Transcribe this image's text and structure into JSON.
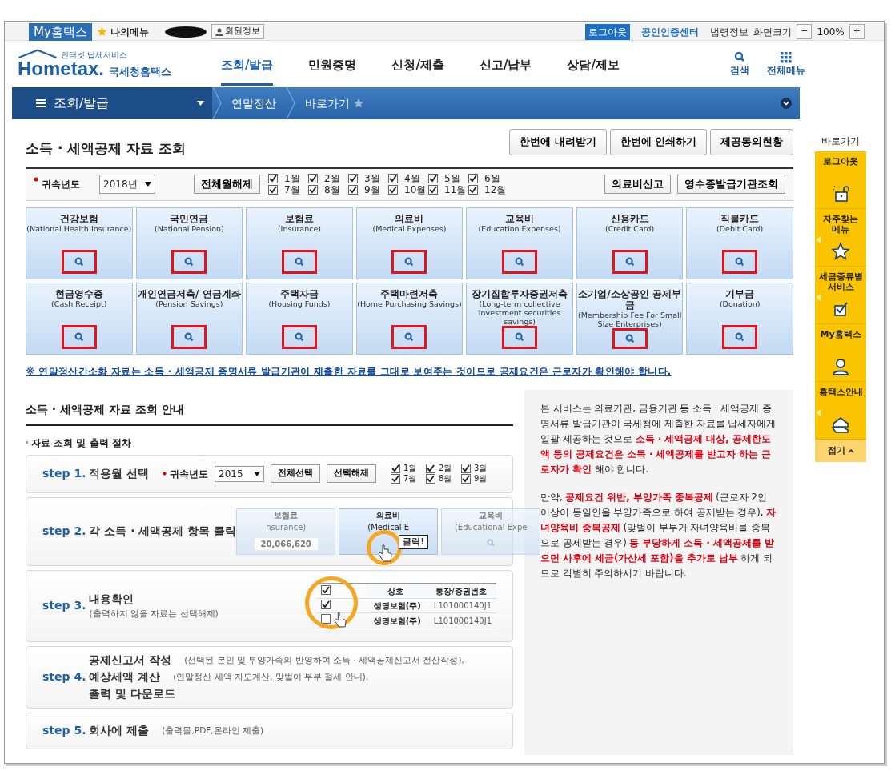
{
  "top_bar": {
    "brand": "My홈택스",
    "my_menu": "나의메뉴",
    "member_info": "회원정보",
    "logout": "로그아웃",
    "cert_center": "공인인증센터",
    "links": [
      "법령정보",
      "화면크기"
    ],
    "zoom_out": "−",
    "zoom": "100%",
    "zoom_in": "+"
  },
  "header": {
    "logo_small": "인터넷 납세서비스",
    "logo": "Hometax.",
    "logo_name": "국세청홈택스",
    "search": "검색",
    "all_menu": "전체메뉴",
    "nav": [
      {
        "label": "조회/발급",
        "selected": true
      },
      {
        "label": "민원증명",
        "selected": false
      },
      {
        "label": "신청/제출",
        "selected": false
      },
      {
        "label": "신고/납부",
        "selected": false
      },
      {
        "label": "상담/제보",
        "selected": false
      }
    ]
  },
  "breadcrumb": {
    "menu": "조회/발급",
    "items": [
      "연말정산",
      "바로가기"
    ]
  },
  "page": {
    "title": "소득 · 세액공제 자료 조회",
    "actions": [
      "한번에 내려받기",
      "한번에 인쇄하기",
      "제공동의현황"
    ]
  },
  "filter": {
    "year_label": "귀속년도",
    "year": "2018년",
    "clear_all": "전체월해제",
    "buttons": [
      "의료비신고",
      "영수증발급기관조회"
    ],
    "months": [
      {
        "label": "1월",
        "checked": true
      },
      {
        "label": "2월",
        "checked": true
      },
      {
        "label": "3월",
        "checked": true
      },
      {
        "label": "4월",
        "checked": true
      },
      {
        "label": "5월",
        "checked": true
      },
      {
        "label": "6월",
        "checked": true
      },
      {
        "label": "7월",
        "checked": true
      },
      {
        "label": "8월",
        "checked": true
      },
      {
        "label": "9월",
        "checked": true
      },
      {
        "label": "10월",
        "checked": true
      },
      {
        "label": "11월",
        "checked": true
      },
      {
        "label": "12월",
        "checked": true
      }
    ]
  },
  "categories": [
    {
      "name": "건강보험",
      "english": "(National Health Insurance)"
    },
    {
      "name": "국민연금",
      "english": "(National Pension)"
    },
    {
      "name": "보험료",
      "english": "(Insurance)"
    },
    {
      "name": "의료비",
      "english": "(Medical Expenses)"
    },
    {
      "name": "교육비",
      "english": "(Education Expenses)"
    },
    {
      "name": "신용카드",
      "english": "(Credit Card)"
    },
    {
      "name": "직불카드",
      "english": "(Debit Card)"
    },
    {
      "name": "현금영수증",
      "english": "(Cash Receipt)"
    },
    {
      "name": "개인연금저축/ 연금계좌",
      "english": "(Pension Savings)"
    },
    {
      "name": "주택자금",
      "english": "(Housing Funds)"
    },
    {
      "name": "주택마련저축",
      "english": "(Home Purchasing Savings)"
    },
    {
      "name": "장기집합투자증권저축",
      "english": "(Long-term collective investment securities savings)"
    },
    {
      "name": "소기업/소상공인 공제부금",
      "english": "(Membership Fee For Small Size Enterprises)"
    },
    {
      "name": "기부금",
      "english": "(Donation)"
    }
  ],
  "notice": "※ 연말정산간소화 자료는 소득 · 세액공제 증명서류 발급기관이 제출한 자료를 그대로 보여주는 것이므로 공제요건은 근로자가 확인해야 합니다.",
  "guide": {
    "title": "소득 · 세액공제 자료 조회 안내",
    "subtitle": "자료 조회 및 출력 절차",
    "steps": [
      {
        "kind": "months",
        "step": "step 1.",
        "lines": [
          {
            "title": "적용월 선택"
          }
        ],
        "year_label": "귀속년도",
        "year": "2015",
        "buttons": [
          "전체선택",
          "선택해제"
        ],
        "months": [
          {
            "label": "1월",
            "checked": true
          },
          {
            "label": "2월",
            "checked": true
          },
          {
            "label": "3월",
            "checked": true
          },
          {
            "label": "7월",
            "checked": true
          },
          {
            "label": "8월",
            "checked": true
          },
          {
            "label": "9월",
            "checked": true
          }
        ]
      },
      {
        "kind": "tiles",
        "step": "step 2.",
        "lines": [
          {
            "title": "각 소득 · 세액공제 항목 클릭"
          }
        ],
        "callout": "클릭!",
        "tiles": [
          {
            "name": "보험료",
            "english": "nsurance)",
            "amount": "20,066,620"
          },
          {
            "name": "의료비",
            "english": "(Medical E"
          },
          {
            "name": "교육비",
            "english": "(Educational Expe"
          }
        ]
      },
      {
        "kind": "table",
        "step": "step 3.",
        "lines": [
          {
            "title": "내용확인"
          }
        ],
        "note": "(출력하지 않을 자료는 선택해제)",
        "columns": [
          "상호",
          "통장/증권번호"
        ],
        "header_checked": true,
        "rows": [
          {
            "checked": true,
            "cells": [
              "생명보험(주)",
              "L101000140J1"
            ]
          },
          {
            "checked": false,
            "cells": [
              "생명보험(주)",
              "L101000140J1"
            ]
          }
        ]
      },
      {
        "kind": "text",
        "step": "step 4.",
        "lines": [
          {
            "title": "공제신고서 작성",
            "note": "(선택된 본인 및 부양가족의 반영하여 소득 · 세액공제신고서 전산작성),"
          },
          {
            "title": "예상세액 계산",
            "note": "(연말정산 세액 자도계산, 맞벌이 부부 절세 안내),"
          },
          {
            "title": "출력 및 다운로드"
          }
        ]
      },
      {
        "kind": "text",
        "step": "step 5.",
        "lines": [
          {
            "title": "회사에 제출",
            "note": "(출력물,PDF,온라인 제출)"
          }
        ]
      }
    ]
  },
  "info": [
    "본 서비스는 의료기관, 금융기관 등 소득 · 세액공제 증명서류 발급기관이 국세청에 제출한 자료를 납세자에게 일괄 제공하는 것으로 **소득 · 세액공제 대상, 공제한도액 등의 공제요건은 소득 · 세액공제를 받고자 하는 근로자가 확인** 해야 합니다.",
    "만약, **공제요건 위반, 부양가족 중복공제** (근로자 2인 이상이 동일인을 부양가족으로 하여 공제받는 경우), **자녀양육비 중복공제** (맞벌이 부부가 자녀양육비를 중복으로 공제받는 경우) **등 부당하게 소득 · 세액공제를 받으면 사후에 세금(가산세 포함)을 추가로 납부** 하게 되므로 각별히 주의하시기 바랍니다."
  ],
  "quick_menu": {
    "title": "바로가기",
    "collapse": "접기",
    "items": [
      {
        "kind": "lock",
        "label": "로그아웃",
        "submenu": false
      },
      {
        "kind": "star",
        "label": "자주찾는 메뉴",
        "submenu": true
      },
      {
        "kind": "check",
        "label": "세금종류별 서비스",
        "submenu": true
      },
      {
        "kind": "person",
        "label": "My홈택스",
        "submenu": false
      },
      {
        "kind": "house",
        "label": "홈택스안내",
        "submenu": true
      }
    ]
  }
}
